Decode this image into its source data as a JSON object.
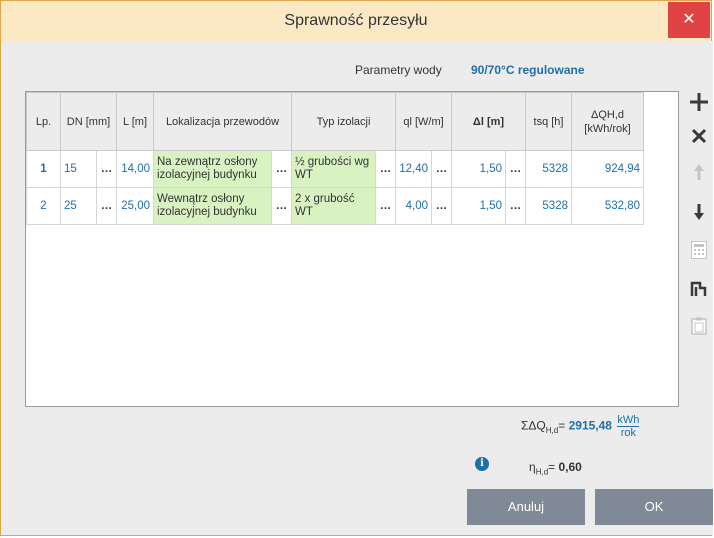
{
  "window": {
    "title": "Sprawność przesyłu",
    "close_glyph": "✕"
  },
  "params": {
    "label": "Parametry wody",
    "value": "90/70°C regulowane"
  },
  "table": {
    "headers": {
      "lp": "Lp.",
      "dn": "DN [mm]",
      "l": "L [m]",
      "lokalizacja": "Lokalizacja przewodów",
      "typ": "Typ izolacji",
      "ql": "ql [W/m]",
      "dl": "Δl [m]",
      "tsq": "tsq [h]",
      "dqhd": "ΔQH,d [kWh/rok]"
    },
    "rows": [
      {
        "lp": "1",
        "dn": "15",
        "l": "14,00",
        "lokalizacja": "Na zewnątrz osłony izolacyjnej budynku",
        "typ": "½ grubości wg WT",
        "ql": "12,40",
        "dl": "1,50",
        "tsq": "5328",
        "dqhd": "924,94"
      },
      {
        "lp": "2",
        "dn": "25",
        "l": "25,00",
        "lokalizacja": "Wewnątrz osłony izolacyjnej budynku",
        "typ": "2 x grubość WT",
        "ql": "4,00",
        "dl": "1,50",
        "tsq": "5328",
        "dqhd": "532,80"
      }
    ],
    "dots": "…"
  },
  "tools": [
    "add-icon",
    "delete-icon",
    "move-up-icon",
    "move-down-icon",
    "calculator-icon",
    "pipe-icon",
    "paste-icon"
  ],
  "summary": {
    "sum_label": "ΣΔQ",
    "sum_sub": "H,d",
    "sum_eq": "=",
    "sum_value": "2915,48",
    "unit_num": "kWh",
    "unit_den": "rok",
    "eta_label": "η",
    "eta_sub": "H,d",
    "eta_eq": "=",
    "eta_value": "0,60",
    "info_glyph": "i"
  },
  "buttons": {
    "cancel": "Anuluj",
    "ok": "OK"
  },
  "colors": {
    "accent": "#1f6fa8",
    "cell_green": "#d9f2c2",
    "title_bg": "#fbe8c5",
    "close_bg": "#e04343",
    "button_bg": "#808a96"
  }
}
